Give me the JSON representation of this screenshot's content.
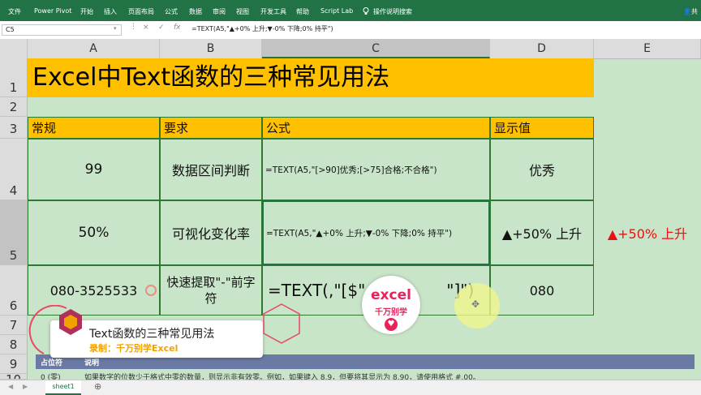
{
  "ribbon": {
    "menu": [
      "文件",
      "Power Pivot",
      "开始",
      "插入",
      "页面布局",
      "公式",
      "数据",
      "审阅",
      "视图",
      "开发工具",
      "帮助",
      "Script Lab",
      "操作说明搜索"
    ],
    "user": "共"
  },
  "formula_bar": {
    "name_box": "C5",
    "formula": "=TEXT(A5,\"▲+0% 上升;▼-0% 下降;0% 持平\")",
    "cancel_glyph": "×",
    "enter_glyph": "✓",
    "fx_glyph": "fx"
  },
  "columns": [
    "A",
    "B",
    "C",
    "D",
    "E"
  ],
  "rows": [
    "1",
    "2",
    "3",
    "4",
    "5",
    "6",
    "7",
    "8",
    "9",
    "10"
  ],
  "title": "Excel中Text函数的三种常见用法",
  "headers": {
    "a": "常规",
    "b": "要求",
    "c": "公式",
    "d": "显示值"
  },
  "row4": {
    "a": "99",
    "b": "数据区间判断",
    "c": "=TEXT(A5,\"[>90]优秀;[>75]合格;不合格\")",
    "d": "优秀"
  },
  "row5": {
    "a": "50%",
    "b": "可视化变化率",
    "c": "=TEXT(A5,\"▲+0% 上升;▼-0% 下降;0% 持平\")",
    "d": "▲+50% 上升",
    "e": "▲+50% 上升"
  },
  "row6": {
    "a": "080-3525533",
    "b": "快速提取\"-\"前字符",
    "c": "=TEXT(,\"[$\"",
    "c_end": "\"]\")",
    "d": "080"
  },
  "row9": {
    "a": "占位符",
    "b": "说明"
  },
  "row10": {
    "a": "0 (零)",
    "b": "如果数字的位数少于格式中零的数量，则显示非有效零。例如，如果键入 8.9，但要将其显示为 8.90，请使用格式 #.00。"
  },
  "overlay": {
    "line1": "Text函数的三种常见用法",
    "line2": "录制：千万别学Excel",
    "logo_line1": "excel",
    "logo_line2": "千万别学",
    "heart": "♥"
  },
  "sheet_tab": "sheet1",
  "add_sheet": "⊕",
  "colors": {
    "excel_green": "#217346",
    "header_yellow": "#ffc000",
    "sheet_bg": "#c9e5c9",
    "red_text": "#e81010"
  }
}
